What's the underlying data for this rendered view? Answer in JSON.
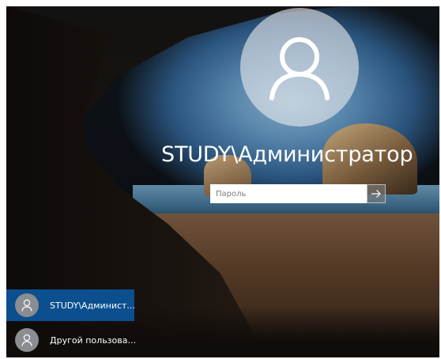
{
  "login": {
    "username": "STUDY\\Администратор",
    "password_placeholder": "Пароль"
  },
  "user_list": [
    {
      "label": "STUDY\\Админист...",
      "selected": true
    },
    {
      "label": "Другой пользова...",
      "selected": false
    }
  ],
  "icons": {
    "avatar": "user-icon",
    "submit": "arrow-right-icon"
  },
  "colors": {
    "selected_user": "#0b4f8f",
    "avatar_circle": "#e6e8ec",
    "text": "#ffffff"
  }
}
